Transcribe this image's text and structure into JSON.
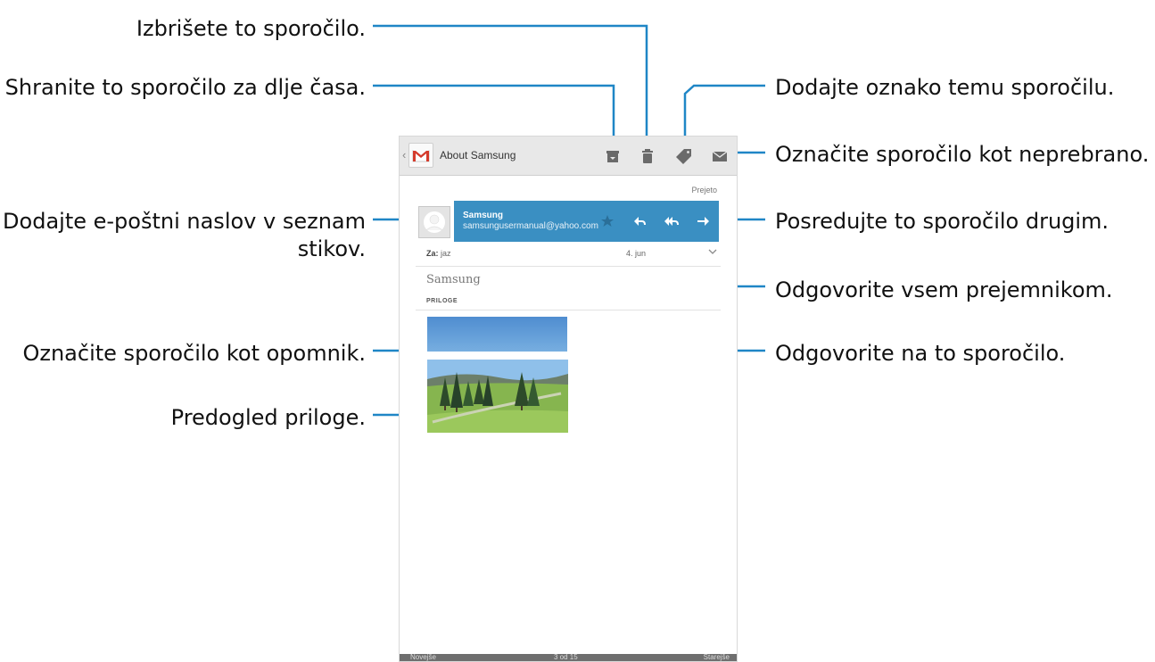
{
  "callouts": {
    "delete": "Izbrišete to sporočilo.",
    "archive": "Shranite to sporočilo za dlje časa.",
    "label": "Dodajte oznako temu sporočilu.",
    "mark_unread": "Označite sporočilo kot neprebrano.",
    "add_contact_line1": "Dodajte e-poštni naslov v seznam",
    "add_contact_line2": "stikov.",
    "forward": "Posredujte to sporočilo drugim.",
    "reply_all": "Odgovorite vsem prejemnikom.",
    "star": "Označite sporočilo kot opomnik.",
    "reply": "Odgovorite na to sporočilo.",
    "preview": "Predogled priloge."
  },
  "app": {
    "title": "About Samsung",
    "received": "Prejeto"
  },
  "message": {
    "sender_name": "Samsung",
    "sender_email": "samsungusermanual@yahoo.com",
    "to_label": "Za:",
    "to_value": "jaz",
    "date": "4. jun",
    "subject": "Samsung",
    "attachments_label": "PRILOGE"
  },
  "bottom": {
    "newer": "Novejše",
    "position": "3 od 15",
    "older": "Starejše"
  },
  "colors": {
    "accent": "#1f86c6",
    "sender_bar": "#3a8fc2"
  },
  "icons": [
    "archive-icon",
    "trash-icon",
    "label-icon",
    "mail-icon",
    "star-icon",
    "reply-icon",
    "reply-all-icon",
    "forward-icon",
    "chevron-down-icon",
    "avatar-icon",
    "gmail-logo"
  ]
}
